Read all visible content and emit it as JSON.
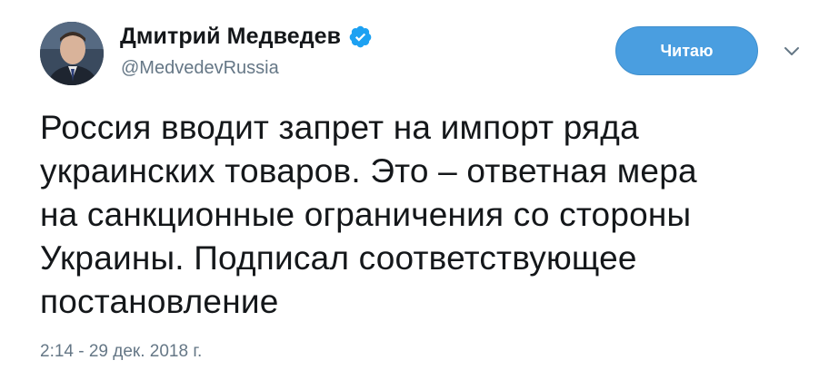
{
  "author": {
    "name": "Дмитрий Медведев",
    "handle": "@MedvedevRussia",
    "verified": true
  },
  "follow_button": {
    "label": "Читаю"
  },
  "menu": {
    "icon": "chevron-down-icon"
  },
  "tweet": {
    "lines": [
      "Россия вводит запрет на импорт ряда",
      "украинских товаров. Это – ответная мера",
      "на санкционные ограничения со стороны",
      "Украины. Подписал соответствующее",
      "постановление"
    ],
    "timestamp": "2:14 - 29 дек. 2018 г."
  },
  "colors": {
    "accent": "#4a9ee0",
    "verified_badge": "#1da1f2",
    "secondary_text": "#657786",
    "primary_text": "#14171a"
  }
}
